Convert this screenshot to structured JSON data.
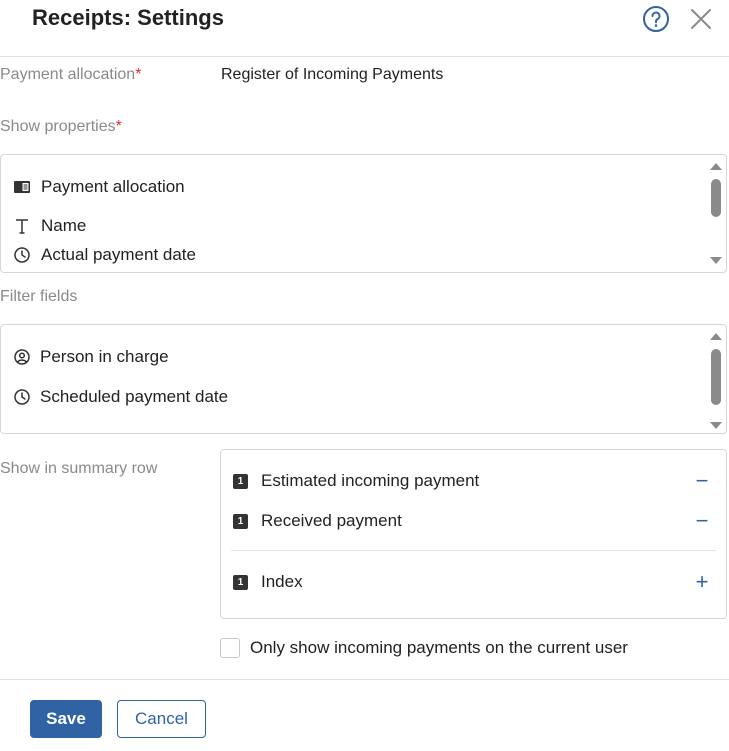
{
  "dialog": {
    "title": "Receipts: Settings"
  },
  "payment_allocation": {
    "label": "Payment allocation",
    "required_mark": "*",
    "value": "Register of Incoming Payments"
  },
  "show_properties": {
    "label": "Show properties",
    "required_mark": "*",
    "items": [
      {
        "label": "Payment allocation",
        "icon": "catalog-icon"
      },
      {
        "label": "Name",
        "icon": "text-type-icon"
      },
      {
        "label": "Actual payment date",
        "icon": "clock-icon"
      }
    ]
  },
  "filter_fields": {
    "label": "Filter fields",
    "items": [
      {
        "label": "Person in charge",
        "icon": "user-circle-icon"
      },
      {
        "label": "Scheduled payment date",
        "icon": "clock-icon"
      }
    ]
  },
  "summary_row": {
    "label": "Show in summary row",
    "badge": "1",
    "selected": [
      {
        "label": "Estimated incoming payment",
        "action": "−"
      },
      {
        "label": "Received payment",
        "action": "−"
      }
    ],
    "available": [
      {
        "label": "Index",
        "action": "+"
      }
    ]
  },
  "only_current_user": {
    "label": "Only show incoming payments on the current user",
    "checked": false
  },
  "buttons": {
    "save": "Save",
    "cancel": "Cancel"
  },
  "colors": {
    "accent": "#2f63a3",
    "required": "#d9302c",
    "label_gray": "#8a8a8a"
  }
}
